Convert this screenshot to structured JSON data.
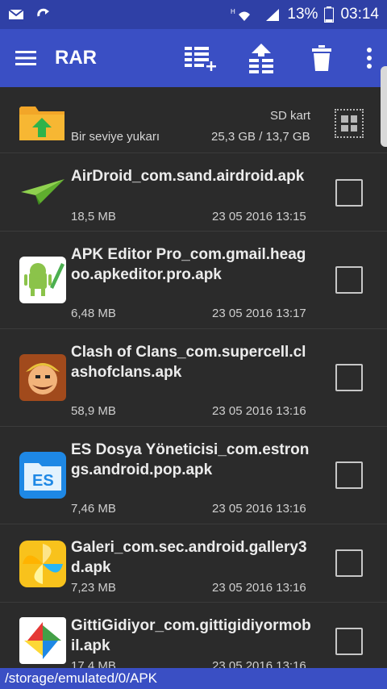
{
  "statusbar": {
    "battery": "13%",
    "time": "03:14",
    "left_icons": [
      "mail-icon",
      "sync-icon"
    ],
    "right_icons": [
      "hd-wifi-icon",
      "signal-icon",
      "battery-icon"
    ]
  },
  "appbar": {
    "title": "RAR",
    "actions": [
      "add-to-archive-icon",
      "extract-icon",
      "delete-icon",
      "more-icon"
    ]
  },
  "storage": {
    "up_label": "Bir seviye yukarı",
    "sd_label": "SD kart",
    "sd_size": "25,3 GB / 13,7 GB"
  },
  "files": [
    {
      "name": "AirDroid_com.sand.airdroid.apk",
      "size": "18,5 MB",
      "date": "23 05 2016 13:15"
    },
    {
      "name": "APK Editor Pro_com.gmail.heagoo.apkeditor.pro.apk",
      "size": "6,48 MB",
      "date": "23 05 2016 13:17"
    },
    {
      "name": "Clash of Clans_com.supercell.clashofclans.apk",
      "size": "58,9 MB",
      "date": "23 05 2016 13:16"
    },
    {
      "name": "ES Dosya Yöneticisi_com.estrongs.android.pop.apk",
      "size": "7,46 MB",
      "date": "23 05 2016 13:16"
    },
    {
      "name": "Galeri_com.sec.android.gallery3d.apk",
      "size": "7,23 MB",
      "date": "23 05 2016 13:16"
    },
    {
      "name": "GittiGidiyor_com.gittigidiyormobil.apk",
      "size": "17,4 MB",
      "date": "23 05 2016 13:16"
    }
  ],
  "path": "/storage/emulated/0/APK",
  "colors": {
    "appbar": "#3a4fc4",
    "statusbar": "#2f40a6",
    "background": "#2b2b2b"
  }
}
